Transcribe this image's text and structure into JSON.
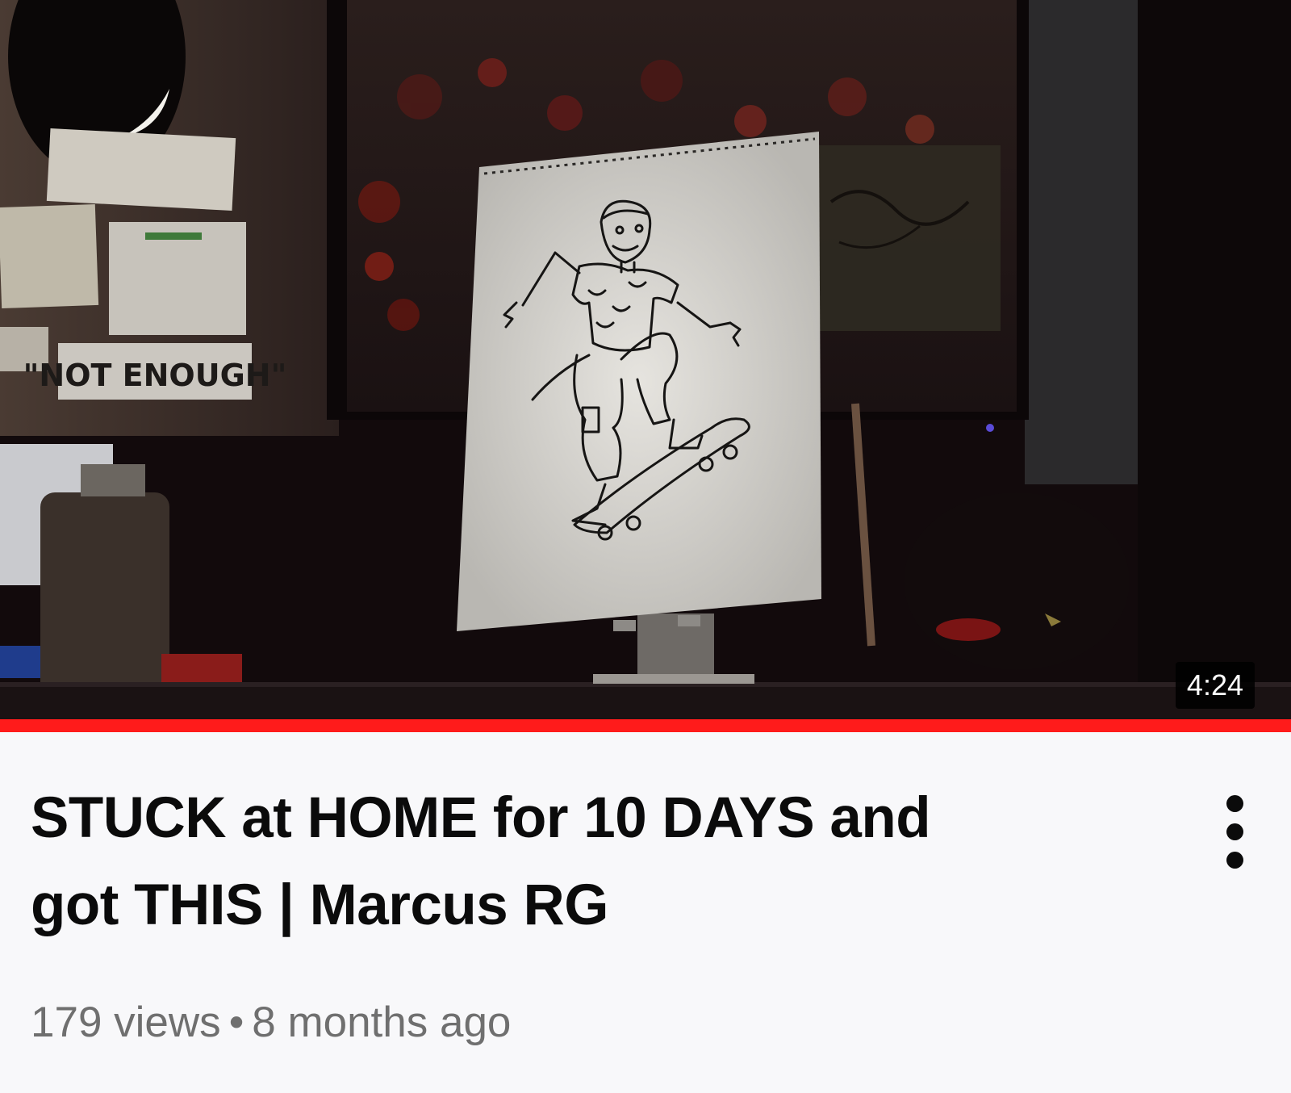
{
  "video": {
    "title": "STUCK at HOME for 10 DAYS and got THIS | Marcus RG",
    "duration": "4:24",
    "views": "179 views",
    "separator": "•",
    "age": "8 months ago",
    "watch_progress": 1.0
  },
  "thumbnail": {
    "sign_text": "\"NOT ENOUGH\""
  },
  "icons": {
    "menu": "more-vertical-icon"
  },
  "colors": {
    "progress": "#ff1b1b",
    "title": "#0b0b0b",
    "stats": "#6f6f6f",
    "background": "#f8f8fa"
  }
}
